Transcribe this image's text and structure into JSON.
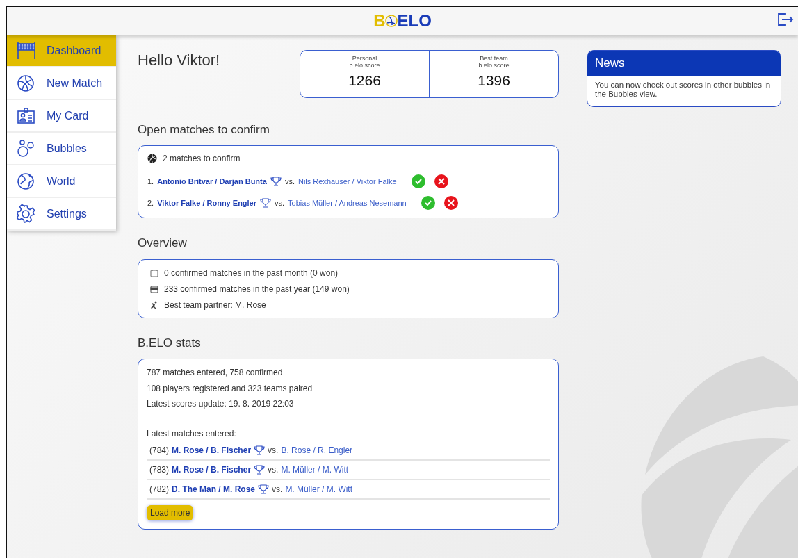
{
  "header": {
    "logo": {
      "prefix": "B",
      "suffix": "ELO"
    }
  },
  "sidebar": {
    "items": [
      {
        "label": "Dashboard",
        "kind": "net",
        "selected": true
      },
      {
        "label": "New Match",
        "kind": "ball",
        "selected": false
      },
      {
        "label": "My Card",
        "kind": "card",
        "selected": false
      },
      {
        "label": "Bubbles",
        "kind": "bubbles",
        "selected": false
      },
      {
        "label": "World",
        "kind": "globe",
        "selected": false
      },
      {
        "label": "Settings",
        "kind": "gear",
        "selected": false
      }
    ]
  },
  "greeting": "Hello Viktor!",
  "scores": [
    {
      "label_lines": [
        "Personal",
        "b.elo score"
      ],
      "value": "1266"
    },
    {
      "label_lines": [
        "Best team",
        "b.elo score"
      ],
      "value": "1396"
    }
  ],
  "open_matches": {
    "title": "Open matches to confirm",
    "summary": "2 matches to confirm",
    "matches": [
      {
        "number": "1.",
        "team": "Antonio Britvar / Darjan Bunta",
        "vs": "vs.",
        "opponent": "Nils Rexhäuser / Viktor Falke"
      },
      {
        "number": "2.",
        "team": "Viktor Falke / Ronny Engler",
        "vs": "vs.",
        "opponent": "Tobias Müller / Andreas Nesemann"
      }
    ]
  },
  "overview": {
    "title": "Overview",
    "items": [
      {
        "kind": "calendar",
        "text": "0 confirmed matches in the past month (0 won)"
      },
      {
        "kind": "year",
        "text": "233 confirmed matches in the past year (149 won)"
      },
      {
        "kind": "player",
        "text": "Best team partner: M. Rose"
      }
    ]
  },
  "stats": {
    "title": "B.ELO stats",
    "lines": [
      "787 matches entered, 758 confirmed",
      "108 players registered and 323 teams paired",
      "Latest scores update: 19. 8. 2019 22:03"
    ],
    "latest_label": "Latest matches entered:",
    "latest": [
      {
        "id": "(784)",
        "team": "M. Rose / B. Fischer",
        "vs": "vs.",
        "opponent": "B. Rose / R. Engler"
      },
      {
        "id": "(783)",
        "team": "M. Rose / B. Fischer",
        "vs": "vs.",
        "opponent": "M. Müller / M. Witt"
      },
      {
        "id": "(782)",
        "team": "D. The Man / M. Rose",
        "vs": "vs.",
        "opponent": "M. Müller / M. Witt"
      }
    ],
    "load_more": "Load more"
  },
  "news": {
    "title": "News",
    "text": "You can now check out scores in other bubbles in the Bubbles view."
  }
}
